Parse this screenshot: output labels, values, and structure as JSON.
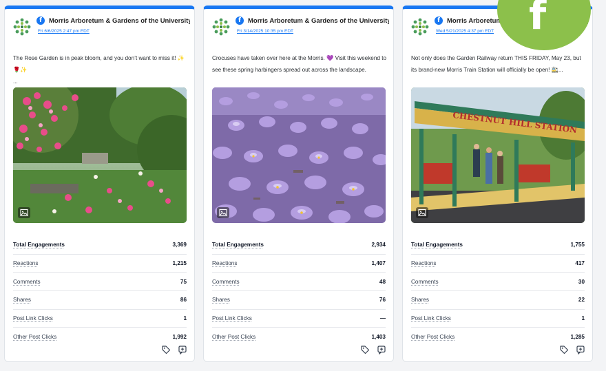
{
  "posts": [
    {
      "org": "Morris Arboretum & Gardens of the University ...",
      "date": "Fri 6/6/2025 2:47 pm EDT",
      "caption": "The Rose Garden is in peak bloom, and you don’t want to miss it! ✨🌹✨",
      "more": "...",
      "metrics": [
        {
          "label": "Total Engagements",
          "value": "3,369"
        },
        {
          "label": "Reactions",
          "value": "1,215"
        },
        {
          "label": "Comments",
          "value": "75"
        },
        {
          "label": "Shares",
          "value": "86"
        },
        {
          "label": "Post Link Clicks",
          "value": "1"
        },
        {
          "label": "Other Post Clicks",
          "value": "1,992"
        }
      ]
    },
    {
      "org": "Morris Arboretum & Gardens of the University ...",
      "date": "Fri 3/14/2025 10:35 pm EDT",
      "caption": "Crocuses have taken over here at the Morris. 💜 Visit this weekend to see these spring harbingers spread out across the landscape.",
      "more": "",
      "metrics": [
        {
          "label": "Total Engagements",
          "value": "2,934"
        },
        {
          "label": "Reactions",
          "value": "1,407"
        },
        {
          "label": "Comments",
          "value": "48"
        },
        {
          "label": "Shares",
          "value": "76"
        },
        {
          "label": "Post Link Clicks",
          "value": "—"
        },
        {
          "label": "Other Post Clicks",
          "value": "1,403"
        }
      ]
    },
    {
      "org": "Morris Arboretum & Gardens of the University ...",
      "date": "Wed 5/21/2025 4:37 pm EDT",
      "caption": "Not only does the Garden Railway return THIS FRIDAY, May 23, but its brand-new Morris Train Station will officially be open! 🚉...",
      "more": "",
      "metrics": [
        {
          "label": "Total Engagements",
          "value": "1,755"
        },
        {
          "label": "Reactions",
          "value": "417"
        },
        {
          "label": "Comments",
          "value": "30"
        },
        {
          "label": "Shares",
          "value": "22"
        },
        {
          "label": "Post Link Clicks",
          "value": "1"
        },
        {
          "label": "Other Post Clicks",
          "value": "1,285"
        }
      ]
    }
  ],
  "station_sign": "CHESTNUT HILL STATION",
  "icons": {
    "network": "facebook-icon",
    "tag": "tag-icon",
    "note": "add-note-icon",
    "image": "image-icon"
  },
  "colors": {
    "accent": "#1877f2",
    "brand_green": "#8cc04b"
  }
}
